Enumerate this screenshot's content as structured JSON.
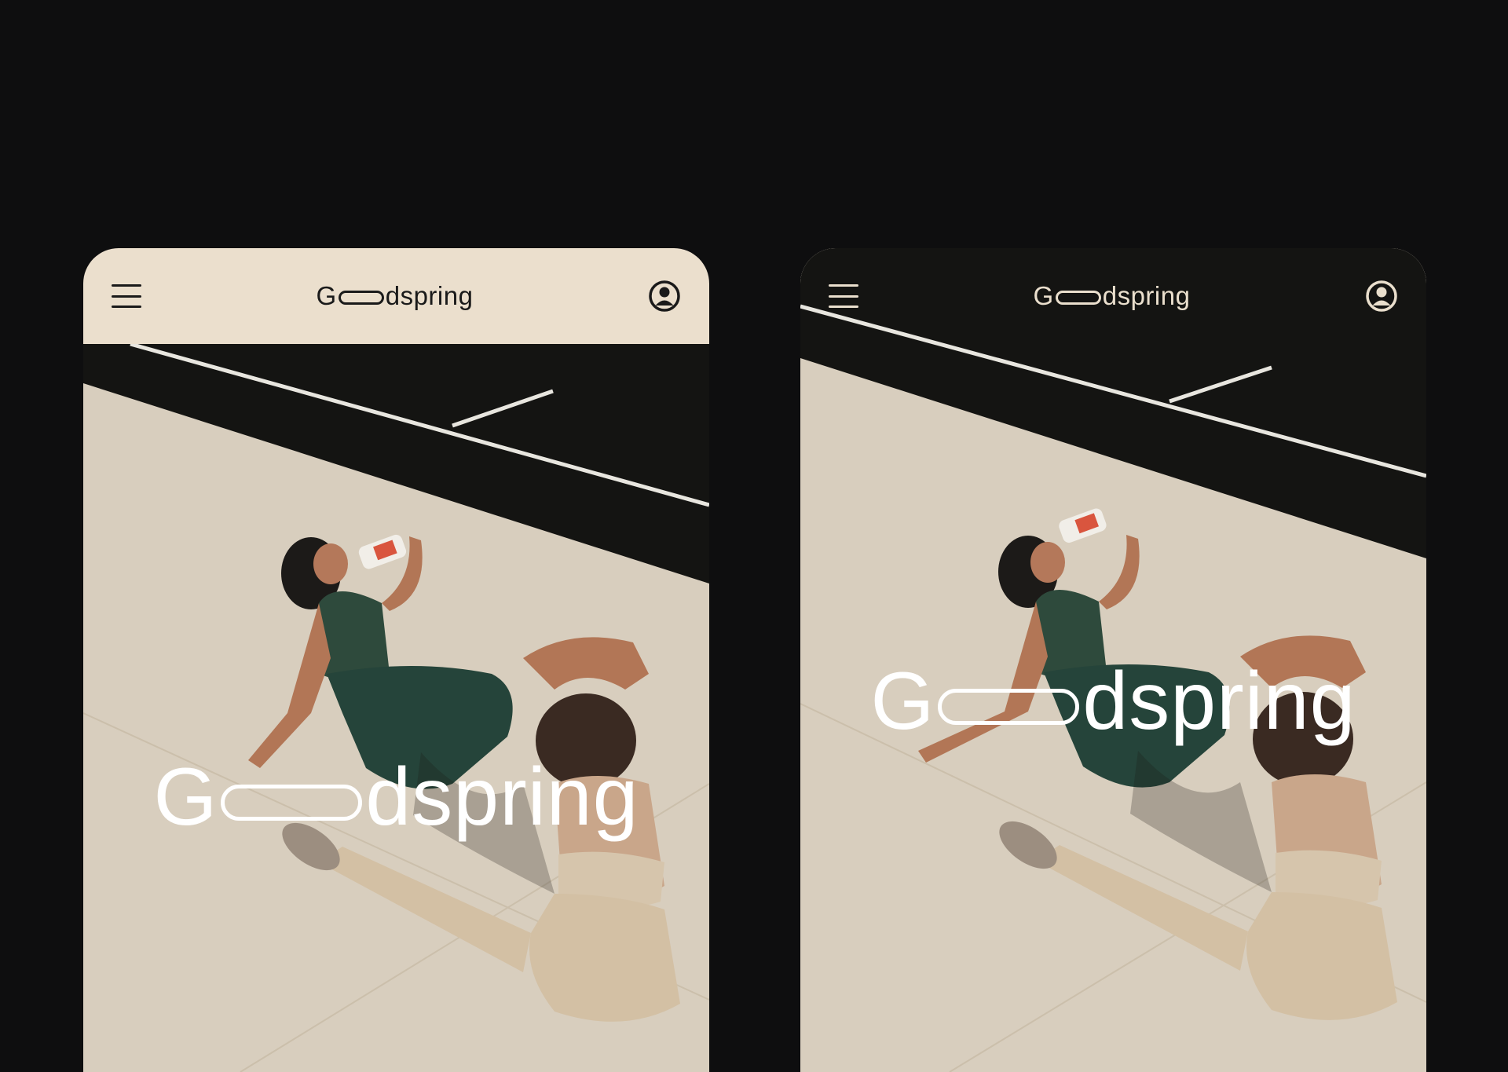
{
  "brand": {
    "prefix": "G",
    "suffix": "dspring"
  },
  "phones": [
    {
      "theme": "light-header",
      "header_bg": "#ebdfcd",
      "header_fg": "#1a1a1a",
      "menu_icon": "hamburger-icon",
      "account_icon": "user-circle-icon"
    },
    {
      "theme": "transparent-header",
      "header_bg": "transparent",
      "header_fg": "#eadfcd",
      "menu_icon": "hamburger-icon",
      "account_icon": "user-circle-icon"
    }
  ],
  "colors": {
    "page_bg": "#0e0e0f",
    "hero_text": "#ffffff",
    "court_dark": "#151513",
    "court_light": "#d9cfbf"
  }
}
